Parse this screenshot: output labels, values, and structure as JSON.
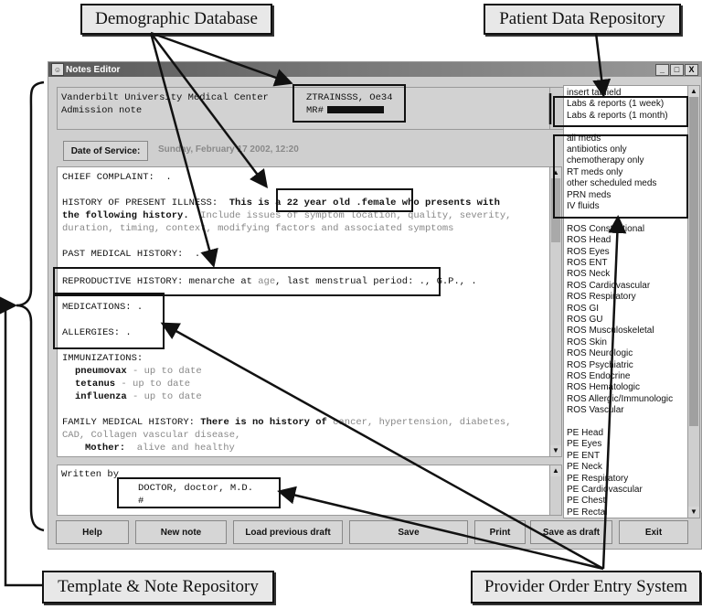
{
  "callouts": {
    "demographic": "Demographic Database",
    "patient_data": "Patient Data Repository",
    "template_note": "Template & Note Repository",
    "provider_order": "Provider Order Entry System"
  },
  "window": {
    "title": "Notes Editor",
    "controls": {
      "minimize": "_",
      "maximize": "□",
      "close": "X"
    }
  },
  "header": {
    "institution": "Vanderbilt University Medical Center",
    "note_type": "Admission note",
    "patient_name": "ZTRAINSSS, Oe34",
    "mr_label": "MR#",
    "mr_value_redacted": true
  },
  "date_of_service": {
    "label": "Date of Service:",
    "value": "Sunday, February 17 2002, 12:20"
  },
  "note": {
    "chief_complaint": {
      "label": "CHIEF COMPLAINT:",
      "value": "  ."
    },
    "hpi": {
      "label": "HISTORY OF PRESENT ILLNESS:",
      "text1": "  This is a 22 year old .female who presents with",
      "text2": "the following history.",
      "hint1": "  Include issues of symptom location, quality, severity,",
      "hint2": "duration, timing, context, modifying factors and associated symptoms"
    },
    "pmh": {
      "label": "PAST MEDICAL HISTORY:",
      "value": "  ."
    },
    "reproductive": {
      "label": "REPRODUCTIVE HISTORY:",
      "text_a": " menarche at ",
      "placeholder": "age",
      "text_b": ", last menstrual period: ., G.P., ."
    },
    "medications": {
      "label": "MEDICATIONS:",
      "value": " ."
    },
    "allergies": {
      "label": "ALLERGIES:",
      "value": " ."
    },
    "immunizations": {
      "label": "IMMUNIZATIONS:",
      "items": [
        {
          "name": "pneumovax",
          "status": " - up to date"
        },
        {
          "name": "tetanus",
          "status": " - up to date"
        },
        {
          "name": "influenza",
          "status": " - up to date"
        }
      ]
    },
    "family_history": {
      "label": "FAMILY MEDICAL HISTORY:",
      "text": " There is no history of",
      "hint1": " cancer, hypertension, diabetes,",
      "hint2": "CAD, Collagen vascular disease,",
      "mother_label": "Mother:",
      "mother_value": "  alive and healthy"
    }
  },
  "signature": {
    "label": "Written by",
    "name": "DOCTOR, doctor, M.D.",
    "number": "#"
  },
  "insert_list": {
    "items": [
      "insert tabfield",
      "Labs & reports (1 week)",
      "Labs & reports (1 month)",
      "",
      "all meds",
      "antibiotics only",
      "chemotherapy only",
      "RT meds only",
      "other scheduled meds",
      "PRN meds",
      "IV fluids",
      "",
      "ROS Constitutional",
      "ROS Head",
      "ROS Eyes",
      "ROS ENT",
      "ROS Neck",
      "ROS Cardiovascular",
      "ROS Respiratory",
      "ROS GI",
      "ROS GU",
      "ROS Musculoskeletal",
      "ROS Skin",
      "ROS Neurologic",
      "ROS Psychiatric",
      "ROS Endocrine",
      "ROS Hematologic",
      "ROS Allergic/Immunologic",
      "ROS Vascular",
      "",
      "PE Head",
      "PE Eyes",
      "PE ENT",
      "PE Neck",
      "PE Respiratory",
      "PE Cardiovascular",
      "PE Chest",
      "PE Rectal"
    ]
  },
  "buttons": {
    "help": "Help",
    "new_note": "New note",
    "load_draft": "Load previous draft",
    "save": "Save",
    "print": "Print",
    "save_draft": "Save as draft",
    "exit": "Exit"
  }
}
